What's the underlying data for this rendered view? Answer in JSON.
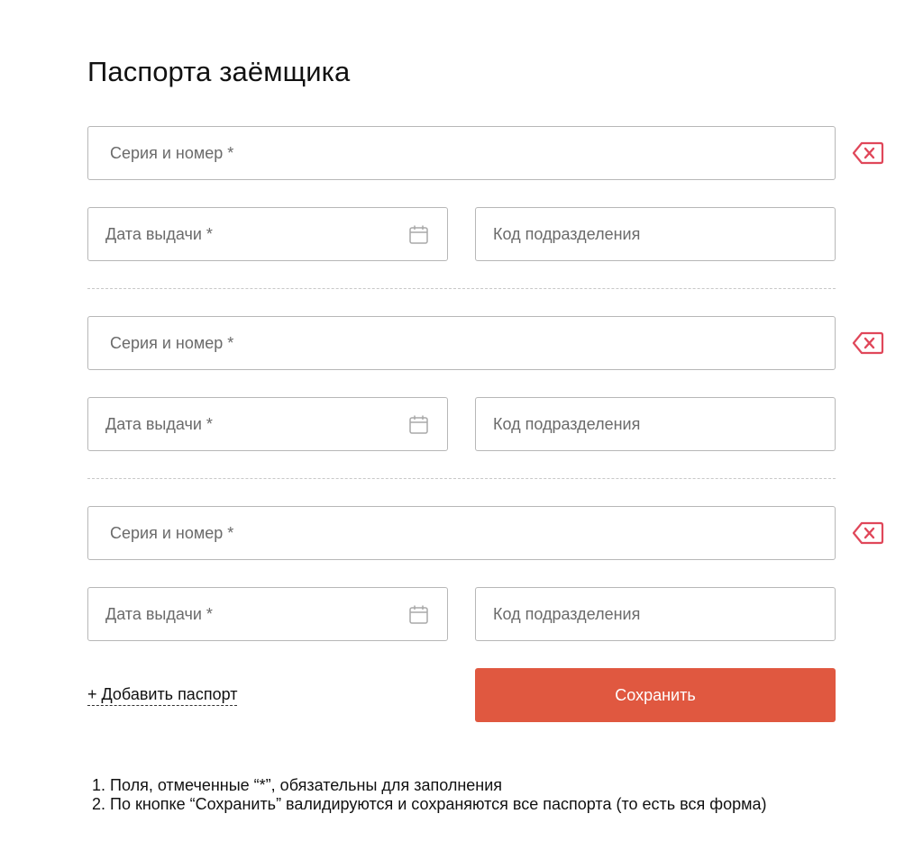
{
  "page": {
    "title": "Паспорта заёмщика"
  },
  "passports": [
    {
      "serial_placeholder": "Серия и номер *",
      "date_placeholder": "Дата выдачи *",
      "code_placeholder": "Код подразделения"
    },
    {
      "serial_placeholder": "Серия и номер *",
      "date_placeholder": "Дата выдачи *",
      "code_placeholder": "Код подразделения"
    },
    {
      "serial_placeholder": "Серия и номер *",
      "date_placeholder": "Дата выдачи *",
      "code_placeholder": "Код подразделения"
    }
  ],
  "icons": {
    "calendar": "calendar-icon",
    "delete": "backspace-delete-icon"
  },
  "actions": {
    "add_label": "+ Добавить паспорт",
    "save_label": "Сохранить"
  },
  "notes": [
    "1. Поля, отмеченные “*”, обязательны для заполнения",
    "2. По кнопке “Сохранить” валидируются и сохраняются все паспорта (то есть вся форма)"
  ],
  "colors": {
    "accent": "#E05840",
    "delete_icon": "#E0475A",
    "border": "#B7B7B7",
    "divider": "#C8C8C8"
  }
}
